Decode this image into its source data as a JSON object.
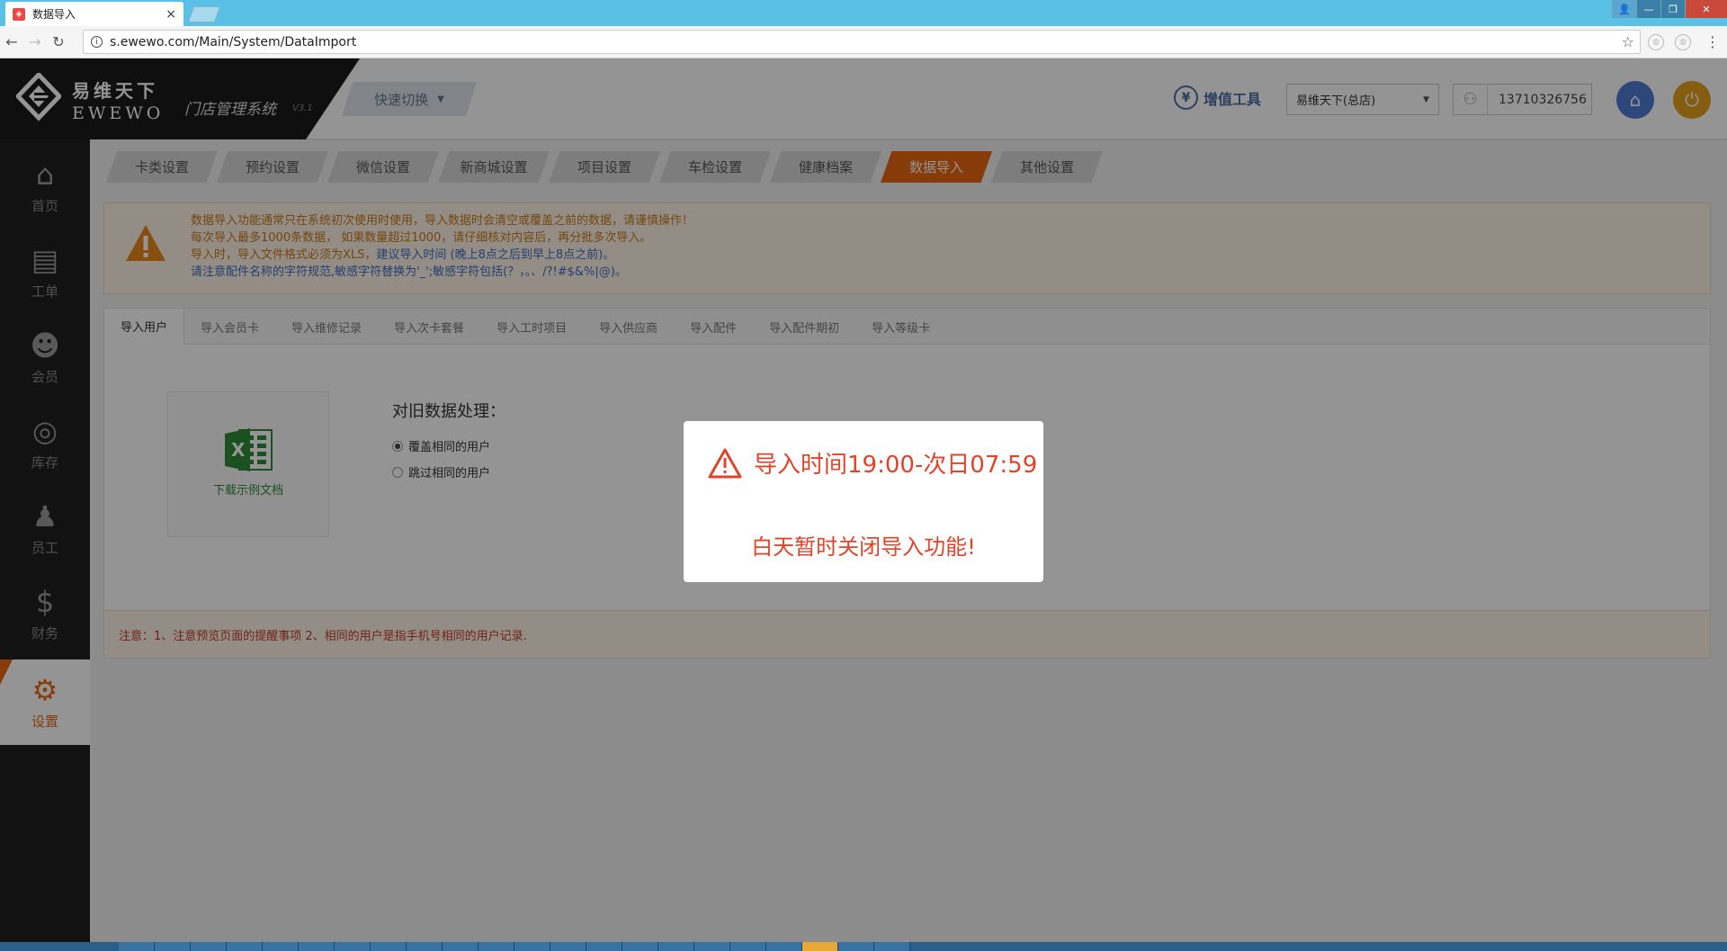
{
  "browser": {
    "tab_title": "数据导入",
    "tab_close": "×",
    "url": "s.ewewo.com/Main/System/DataImport",
    "info_glyph": "i",
    "star_glyph": "☆",
    "back_glyph": "←",
    "forward_glyph": "→",
    "reload_glyph": "↻",
    "menu_glyph": "⋮",
    "win_user": "👤",
    "win_min": "—",
    "win_max": "❐",
    "win_close": "✕"
  },
  "header": {
    "logo_cn": "易维天下",
    "logo_en": "EWEWO",
    "system_name": "门店管理系统",
    "version": "V3.1",
    "quick_switch": "快速切换",
    "quick_switch_caret": "▼",
    "vat_icon": "¥",
    "vat_label": "增值工具",
    "store": "易维天下(总店)",
    "store_arrow": "▼",
    "phone": "13710326756",
    "user_glyph": "⚇",
    "home_glyph": "⌂",
    "power_glyph": "⏻"
  },
  "sidebar": {
    "items": [
      {
        "label": "首页",
        "icon": "home-icon",
        "glyph": "⌂"
      },
      {
        "label": "工单",
        "icon": "workorder-icon",
        "glyph": "▤"
      },
      {
        "label": "会员",
        "icon": "member-icon",
        "glyph": "☻"
      },
      {
        "label": "库存",
        "icon": "inventory-icon",
        "glyph": "◎"
      },
      {
        "label": "员工",
        "icon": "staff-icon",
        "glyph": "♟"
      },
      {
        "label": "财务",
        "icon": "finance-icon",
        "glyph": "$"
      },
      {
        "label": "设置",
        "icon": "settings-icon",
        "glyph": "⚙"
      }
    ],
    "active_index": 6
  },
  "settings_tabs": [
    "卡类设置",
    "预约设置",
    "微信设置",
    "新商城设置",
    "项目设置",
    "车检设置",
    "健康档案",
    "数据导入",
    "其他设置"
  ],
  "settings_tabs_active": 7,
  "warning": {
    "line1": "数据导入功能通常只在系统初次使用时使用，导入数据时会清空或覆盖之前的数据，请谨慎操作！",
    "line2": "每次导入最多1000条数据， 如果数量超过1000，请仔细核对内容后，再分批多次导入。",
    "line3a": "导入时，导入文件格式必须为XLS，",
    "line3b": "建议导入时间 (晚上8点之后到早上8点之前)。",
    "line4": "请注意配件名称的字符规范,敏感字符替换为'_';敏感字符包括(？，。、/?!#$&%|@)。"
  },
  "import_tabs": [
    "导入用户",
    "导入会员卡",
    "导入维修记录",
    "导入次卡套餐",
    "导入工时项目",
    "导入供应商",
    "导入配件",
    "导入配件期初",
    "导入等级卡"
  ],
  "import_tabs_active": 0,
  "import_panel": {
    "sample_download": "下载示例文档",
    "old_data_title": "对旧数据处理：",
    "options": [
      {
        "label": "覆盖相同的用户",
        "checked": true
      },
      {
        "label": "跳过相同的用户",
        "checked": false
      }
    ],
    "note": "注意：1、注意预览页面的提醒事项    2、相同的用户是指手机号相同的用户记录."
  },
  "modal": {
    "title": "导入时间19:00-次日07:59",
    "message": "白天暂时关闭导入功能!"
  },
  "colors": {
    "accent": "#e8660e",
    "modal_text": "#e0442b",
    "sidebar_bg": "#1f1f1f"
  }
}
